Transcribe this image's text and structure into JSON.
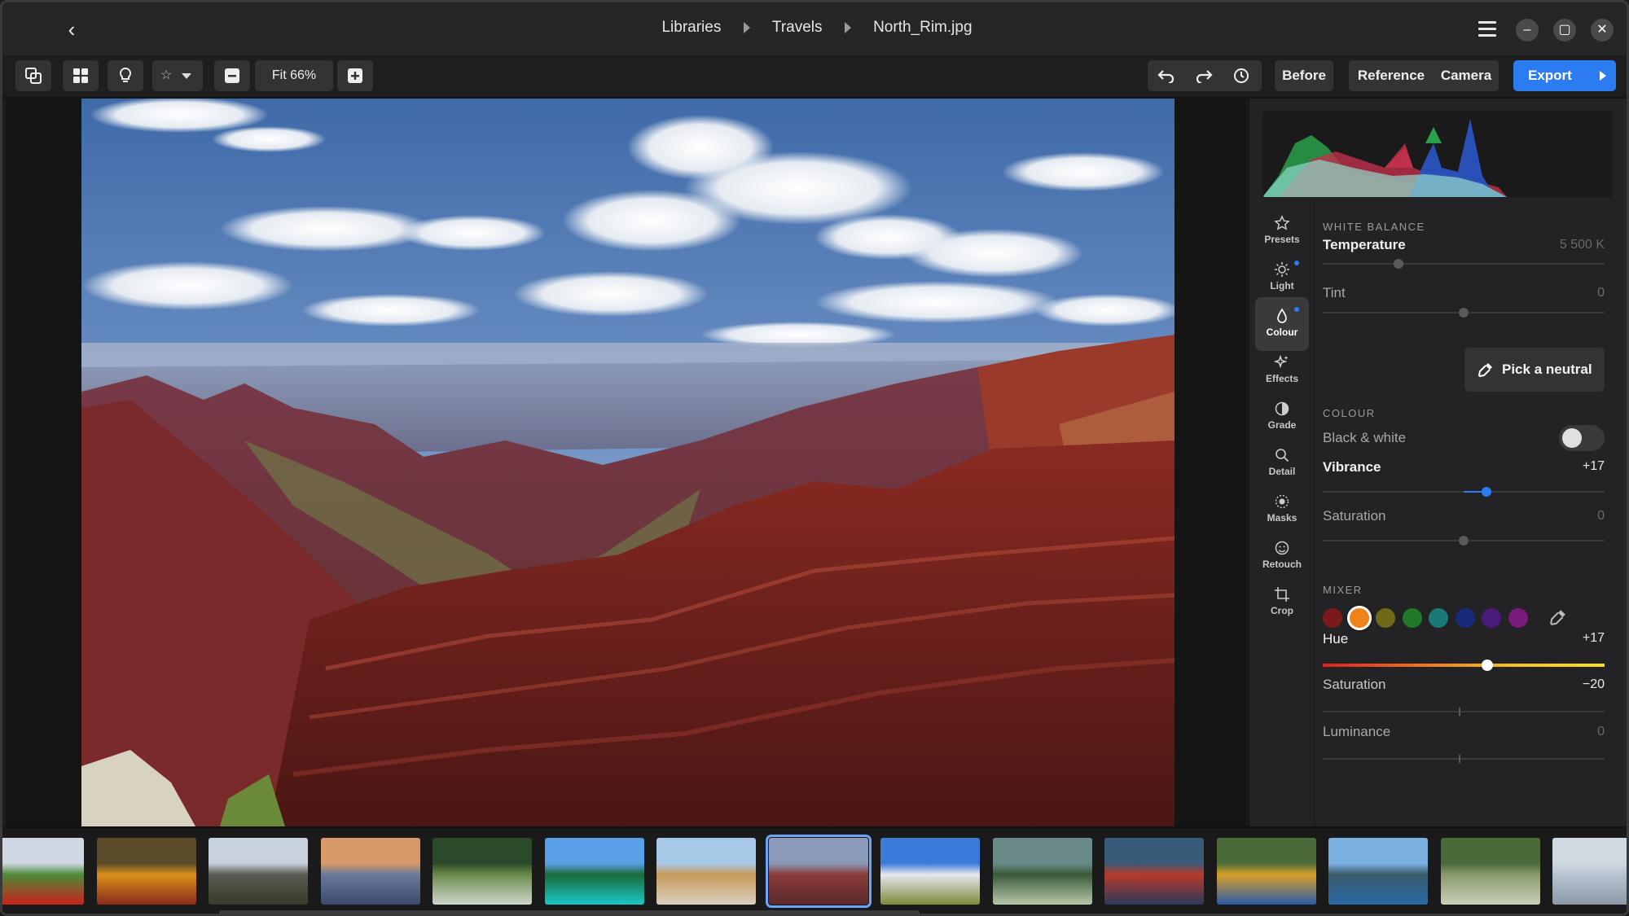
{
  "breadcrumb": {
    "items": [
      "Libraries",
      "Travels",
      "North_Rim.jpg"
    ]
  },
  "toolbar": {
    "zoom_label": "Fit 66%",
    "before_label": "Before",
    "reference_label": "Reference",
    "camera_label": "Camera",
    "export_label": "Export"
  },
  "rail": {
    "items": [
      {
        "label": "Presets",
        "icon": "star-icon"
      },
      {
        "label": "Light",
        "icon": "sun-icon",
        "modified": true
      },
      {
        "label": "Colour",
        "icon": "drop-icon",
        "modified": true,
        "active": true
      },
      {
        "label": "Effects",
        "icon": "sparkle-icon"
      },
      {
        "label": "Grade",
        "icon": "half-circle-icon"
      },
      {
        "label": "Detail",
        "icon": "magnifier-icon"
      },
      {
        "label": "Masks",
        "icon": "mask-icon"
      },
      {
        "label": "Retouch",
        "icon": "face-icon"
      },
      {
        "label": "Crop",
        "icon": "crop-icon"
      }
    ]
  },
  "white_balance": {
    "section": "WHITE BALANCE",
    "temperature": {
      "label": "Temperature",
      "value": "5 500 K",
      "level": 0.27
    },
    "tint": {
      "label": "Tint",
      "value": "0",
      "level": 0.5
    },
    "pick_label": "Pick a neutral"
  },
  "colour": {
    "section": "COLOUR",
    "bw_label": "Black & white",
    "bw_on": false,
    "vibrance": {
      "label": "Vibrance",
      "value": "+17",
      "level": 0.58
    },
    "saturation": {
      "label": "Saturation",
      "value": "0",
      "level": 0.5
    }
  },
  "mixer": {
    "section": "MIXER",
    "swatches": [
      "#7a1a1a",
      "#f0821a",
      "#6e6a1a",
      "#1f7a2a",
      "#1a7a78",
      "#1a2a7a",
      "#4a1a7a",
      "#7a1a7a"
    ],
    "selected_index": 1,
    "hue": {
      "label": "Hue",
      "value": "+17",
      "level": 0.58
    },
    "saturation": {
      "label": "Saturation",
      "value": "−20",
      "level": 0.5
    },
    "luminance": {
      "label": "Luminance",
      "value": "0",
      "level": 0.5
    }
  },
  "filmstrip": {
    "count": 15,
    "selected_index": 7
  },
  "colors": {
    "accent": "#2b7cf0",
    "panel": "#232325",
    "background": "#1e1e1f"
  }
}
